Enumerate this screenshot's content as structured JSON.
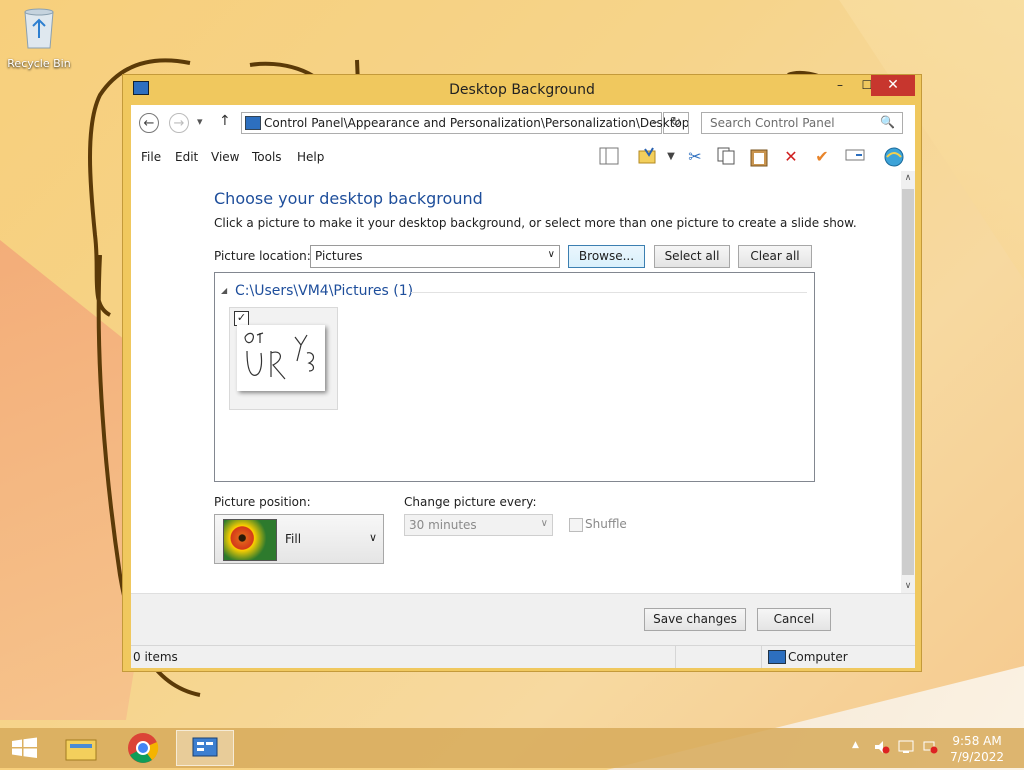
{
  "desktop": {
    "recycle_bin_label": "Recycle Bin"
  },
  "window": {
    "title": "Desktop Background",
    "controls": {
      "minimize": "–",
      "maximize": "☐",
      "close": "✕"
    }
  },
  "nav": {
    "back": "←",
    "forward": "→",
    "recent": "▾",
    "up": "↑",
    "address": "Control Panel\\Appearance and Personalization\\Personalization\\Desktop",
    "address_dropdown": "⌄",
    "refresh": "↻",
    "search_placeholder": "Search Control Panel",
    "search_icon": "🔍"
  },
  "menu": [
    "File",
    "Edit",
    "View",
    "Tools",
    "Help"
  ],
  "toolbar_icons": [
    "layout-icon",
    "folder-properties-icon",
    "dropdown-icon",
    "cut-icon",
    "copy-icon",
    "paste-icon",
    "delete-icon",
    "checkmark-icon",
    "rename-icon",
    "internet-icon"
  ],
  "main": {
    "heading": "Choose your desktop background",
    "description": "Click a picture to make it your desktop background, or select more than one picture to create a slide show.",
    "picture_location_label": "Picture location:",
    "picture_location_value": "Pictures",
    "browse_button": "Browse...",
    "select_all_button": "Select all",
    "clear_all_button": "Clear all",
    "group_header": "C:\\Users\\VM4\\Pictures (1)",
    "group_arrow": "◢",
    "picture_checked": "✓",
    "picture_position_label": "Picture position:",
    "picture_position_value": "Fill",
    "change_picture_label": "Change picture every:",
    "change_picture_value": "30 minutes",
    "shuffle_label": "Shuffle"
  },
  "footer": {
    "save_button": "Save changes",
    "cancel_button": "Cancel"
  },
  "status": {
    "items": "0 items",
    "computer": "Computer"
  },
  "taskbar": {
    "time": "9:58 AM",
    "date": "7/9/2022"
  },
  "colors": {
    "title_bar": "#f0c85e",
    "close_button": "#c7362e",
    "heading_blue": "#1e4e9b"
  }
}
